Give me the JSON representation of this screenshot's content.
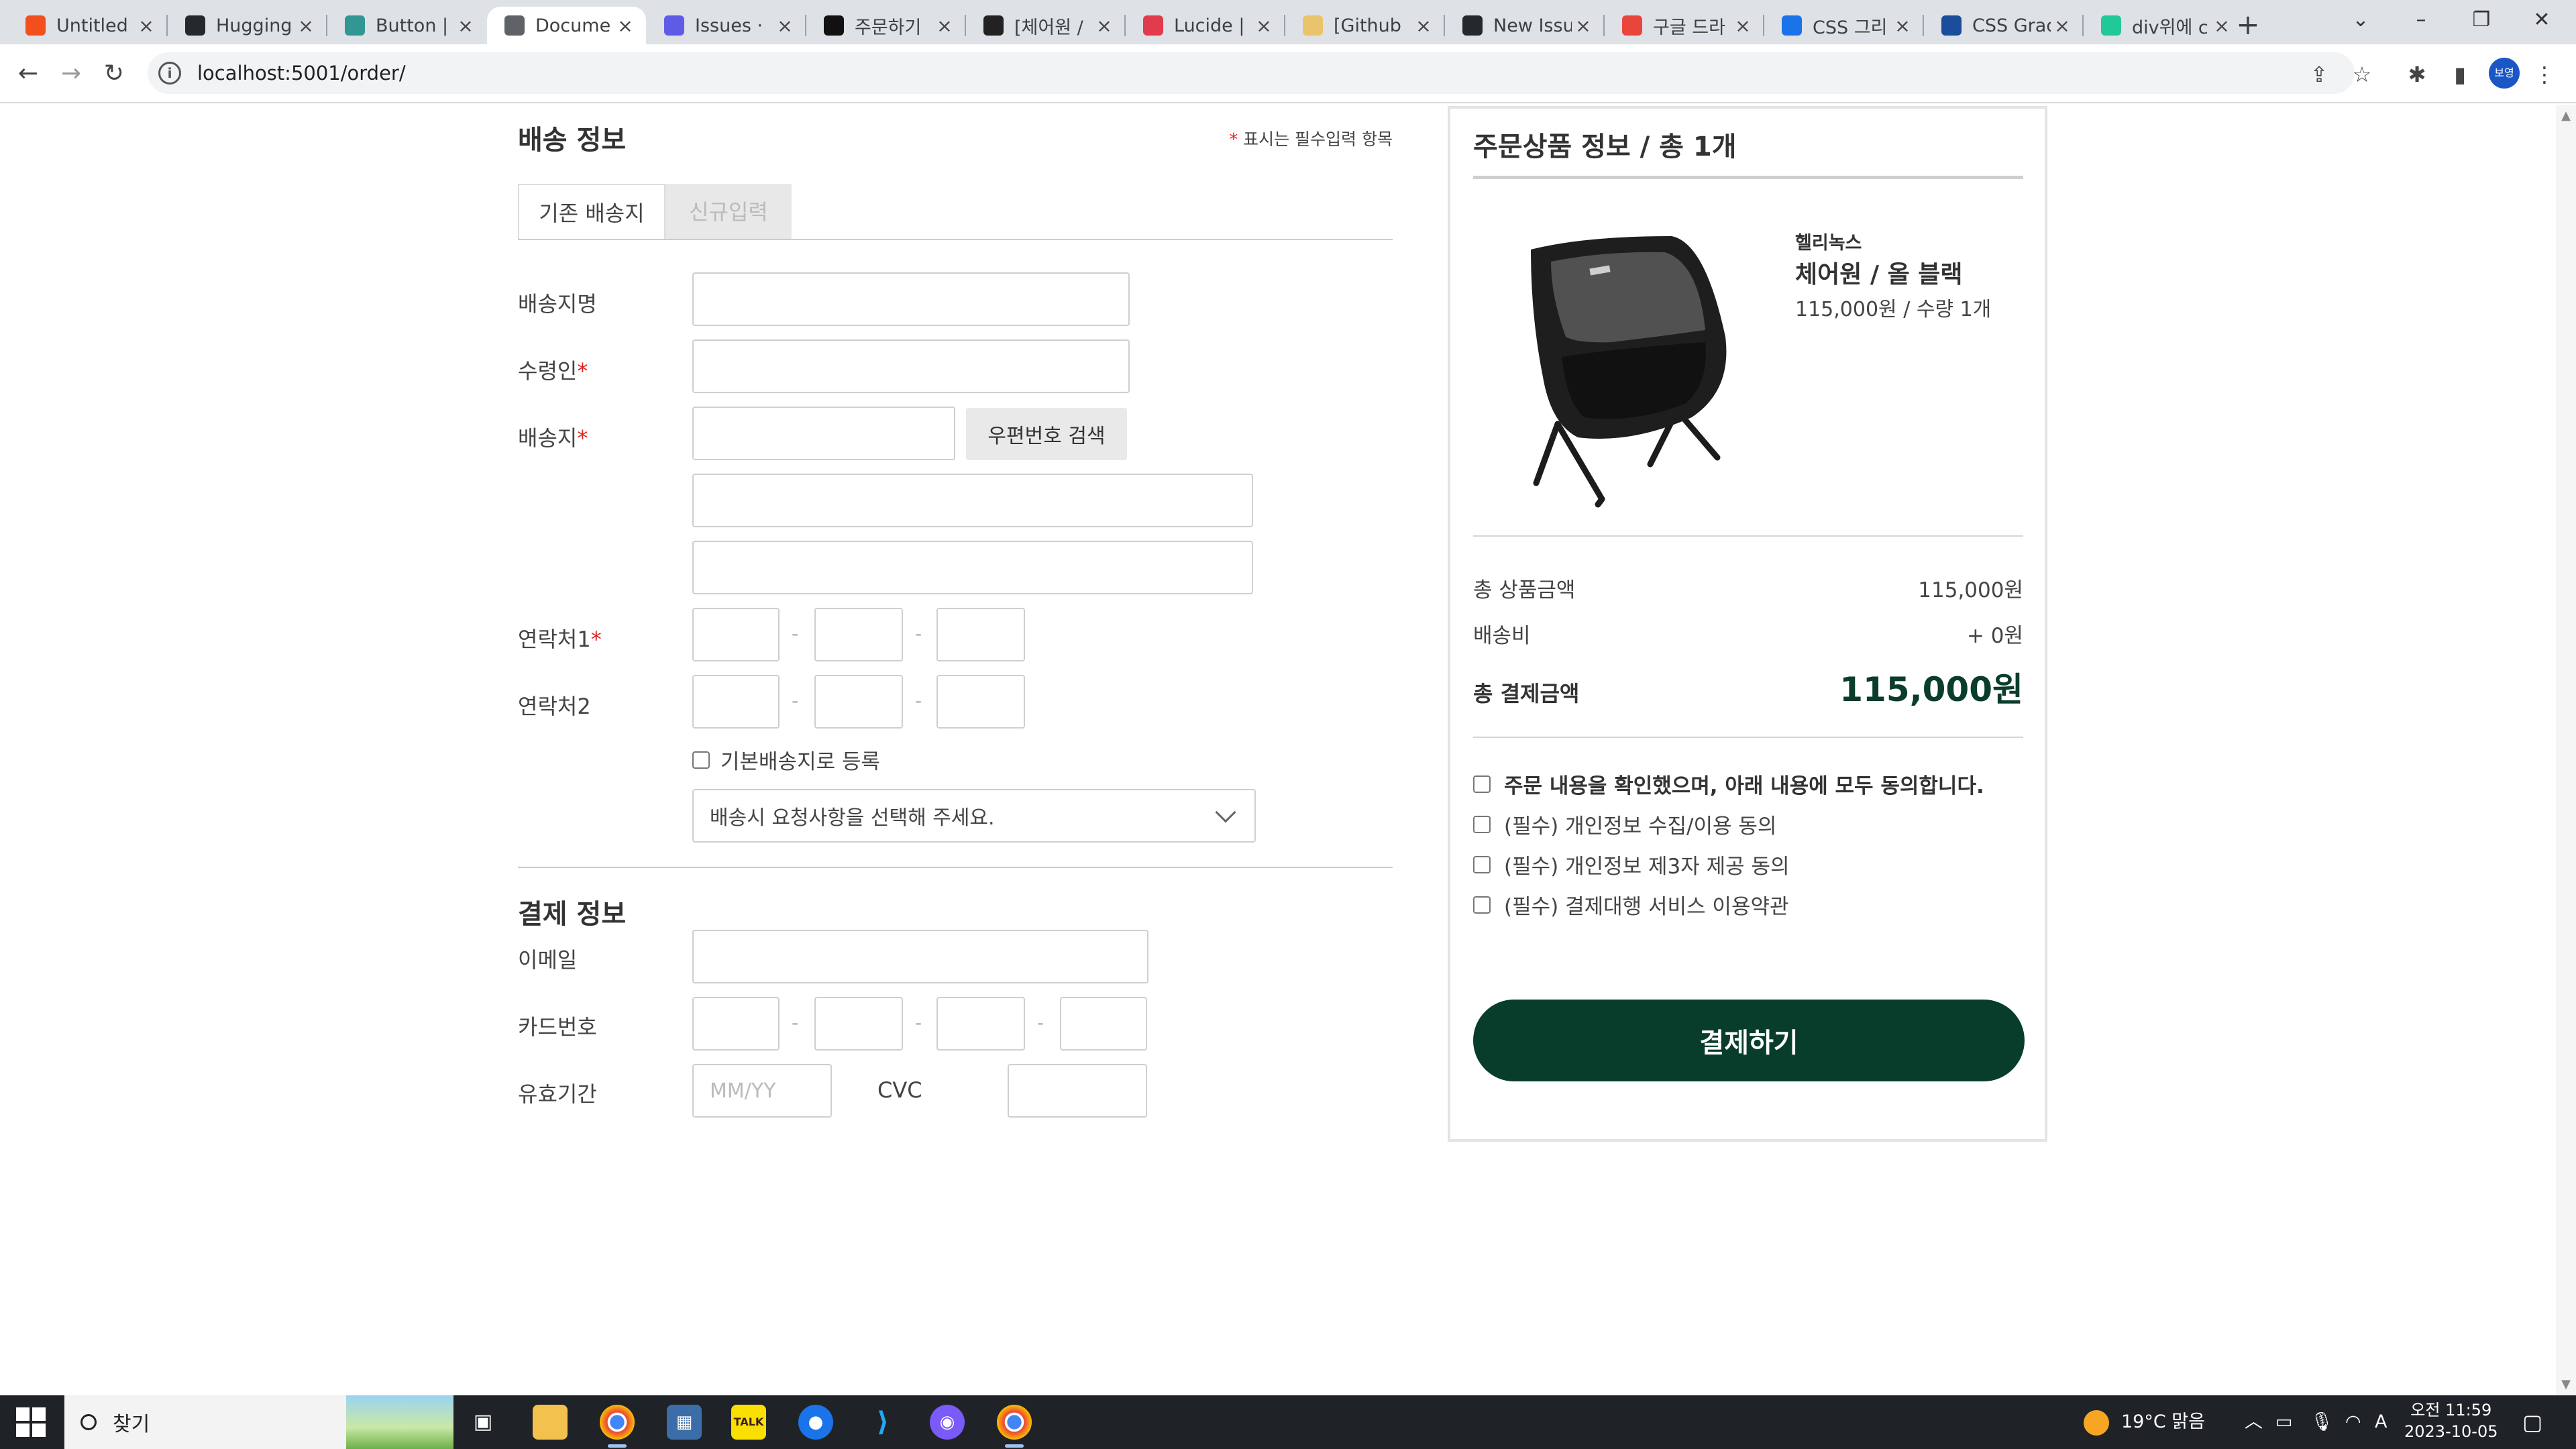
{
  "browser": {
    "tabs": [
      {
        "title": "Untitled",
        "icon": "figma-icon",
        "color": "#f24e1e"
      },
      {
        "title": "Hugging",
        "icon": "github-icon",
        "color": "#24292e"
      },
      {
        "title": "Button |",
        "icon": "chakra-icon",
        "color": "#319795"
      },
      {
        "title": "Docume",
        "icon": "globe-icon",
        "color": "#5f6368"
      },
      {
        "title": "Issues ·",
        "icon": "jira-icon",
        "color": "#5e5ce6"
      },
      {
        "title": "주문하기",
        "icon": "29cm-icon",
        "color": "#111111"
      },
      {
        "title": "[체어원 /",
        "icon": "diamond-icon",
        "color": "#222222"
      },
      {
        "title": "Lucide |",
        "icon": "lucide-icon",
        "color": "#e23b4e"
      },
      {
        "title": "[Github",
        "icon": "chatgpt-icon",
        "color": "#e9c46a"
      },
      {
        "title": "New Issu",
        "icon": "github-icon",
        "color": "#24292e"
      },
      {
        "title": "구글 드라",
        "icon": "t-icon",
        "color": "#e8453c"
      },
      {
        "title": "CSS 그리",
        "icon": "grid-icon",
        "color": "#1a73e8"
      },
      {
        "title": "CSS Grac",
        "icon": "circle-icon",
        "color": "#1a4d9c"
      },
      {
        "title": "div위에 c",
        "icon": "v-icon",
        "color": "#20c997"
      }
    ],
    "url": "localhost:5001/order/",
    "profile": "보영"
  },
  "shipping": {
    "title": "배송 정보",
    "required_note_star": "*",
    "required_note": " 표시는 필수입력 항목",
    "tab_existing": "기존 배송지",
    "tab_new": "신규입력",
    "label_name": "배송지명",
    "label_receiver": "수령인",
    "label_address": "배송지",
    "label_phone1": "연락처1",
    "label_phone2": "연락처2",
    "star": "*",
    "zip_button": "우편번호 검색",
    "dash": "-",
    "default_checkbox": "기본배송지로 등록",
    "request_select": "배송시 요청사항을 선택해 주세요."
  },
  "payment": {
    "title": "결제 정보",
    "label_email": "이메일",
    "label_card": "카드번호",
    "label_expiry": "유효기간",
    "expiry_placeholder": "MM/YY",
    "label_cvc": "CVC"
  },
  "summary": {
    "title": "주문상품 정보 / 총 1개",
    "brand": "헬리녹스",
    "product_name": "체어원 / 올 블랙",
    "product_price": "115,000원 / 수량 1개",
    "subtotal_label": "총 상품금액",
    "subtotal_value": "115,000원",
    "shipping_label": "배송비",
    "shipping_value": "+ 0원",
    "total_label": "총 결제금액",
    "total_value": "115,000원",
    "agree_all": "주문 내용을 확인했으며, 아래 내용에 모두 동의합니다.",
    "agree_privacy": "(필수) 개인정보 수집/이용 동의",
    "agree_third": "(필수) 개인정보 제3자 제공 동의",
    "agree_pg": "(필수) 결제대행 서비스 이용약관",
    "pay_button": "결제하기"
  },
  "taskbar": {
    "search": "찾기",
    "weather": "19°C 맑음",
    "time": "오전 11:59",
    "date": "2023-10-05",
    "ime": "A"
  },
  "colors": {
    "accent": "#073d2a",
    "required": "#e02020"
  }
}
